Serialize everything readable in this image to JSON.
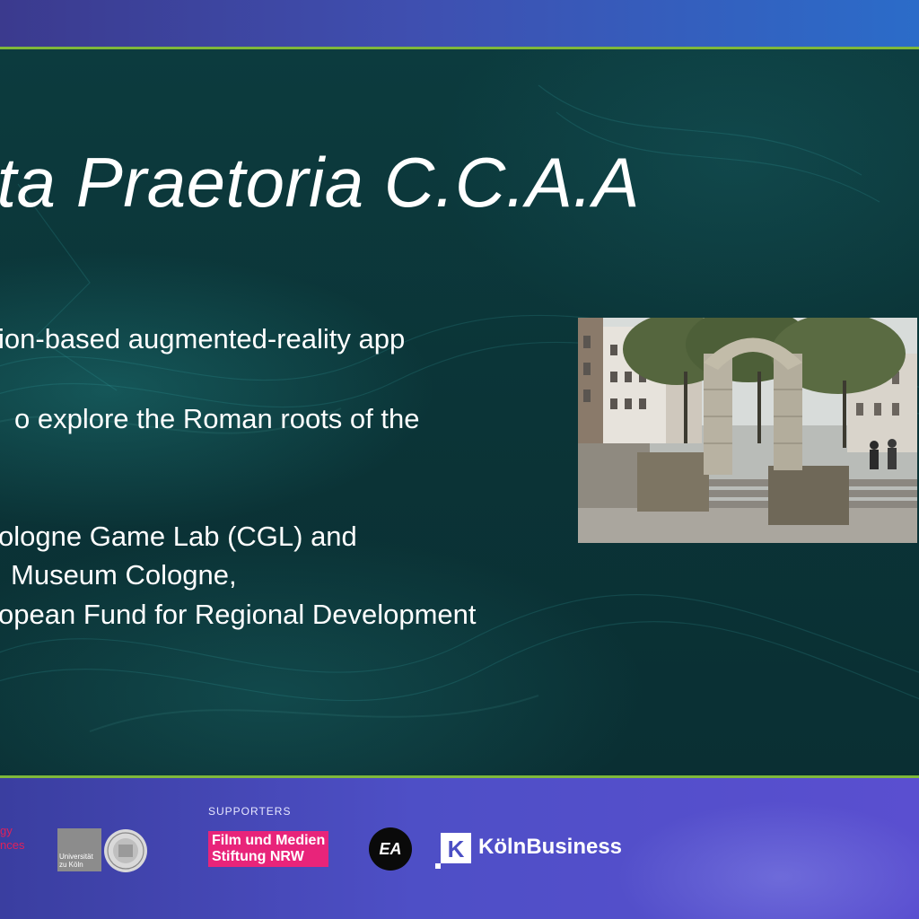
{
  "slide": {
    "title": "rta Praetoria C.C.A.A",
    "lines": [
      "ion-based augmented-reality app",
      "o explore the Roman roots of the",
      "ologne Game Lab (CGL) and",
      "Museum Cologne,",
      "opean Fund for Regional Development"
    ],
    "photo_subject": "Roman gate ruins (arch) in a city square"
  },
  "footer": {
    "partner_red_lines": [
      "gy",
      "nces"
    ],
    "university_label": "Universität zu Köln",
    "supporters_heading": "SUPPORTERS",
    "film_stiftung_lines": [
      "Film und Medien",
      "Stiftung NRW"
    ],
    "ea_logo_text": "EA",
    "koeln_icon_letter": "K",
    "koelnbusiness_text": "KölnBusiness"
  },
  "colors": {
    "accent_rule": "#7fb83a",
    "slide_bg": "#0b3437",
    "film_stiftung_pink": "#e8247a",
    "partner_red": "#e0205a"
  }
}
